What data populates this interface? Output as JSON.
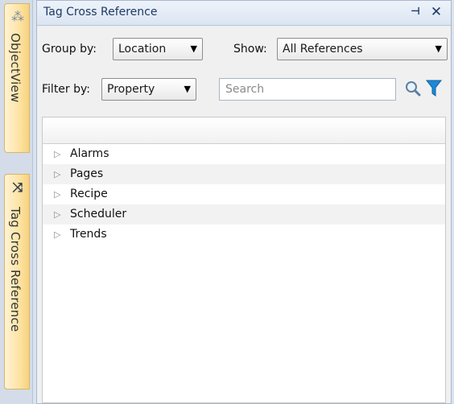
{
  "dock": {
    "tabs": [
      {
        "label": "ObjectView",
        "icon": "object-view-icon"
      },
      {
        "label": "Tag Cross Reference",
        "icon": "shuffle-icon"
      }
    ]
  },
  "panel": {
    "title": "Tag Cross Reference",
    "group_by": {
      "label": "Group by:",
      "value": "Location"
    },
    "show": {
      "label": "Show:",
      "value": "All References"
    },
    "filter_by": {
      "label": "Filter by:",
      "value": "Property"
    },
    "search": {
      "placeholder": "Search"
    }
  },
  "tree": {
    "items": [
      {
        "label": "Alarms"
      },
      {
        "label": "Pages"
      },
      {
        "label": "Recipe"
      },
      {
        "label": "Scheduler"
      },
      {
        "label": "Trends"
      }
    ]
  },
  "colors": {
    "accent": "#1f3a64",
    "tab_background": "#fde3a4",
    "filter_icon": "#1e88d8"
  }
}
